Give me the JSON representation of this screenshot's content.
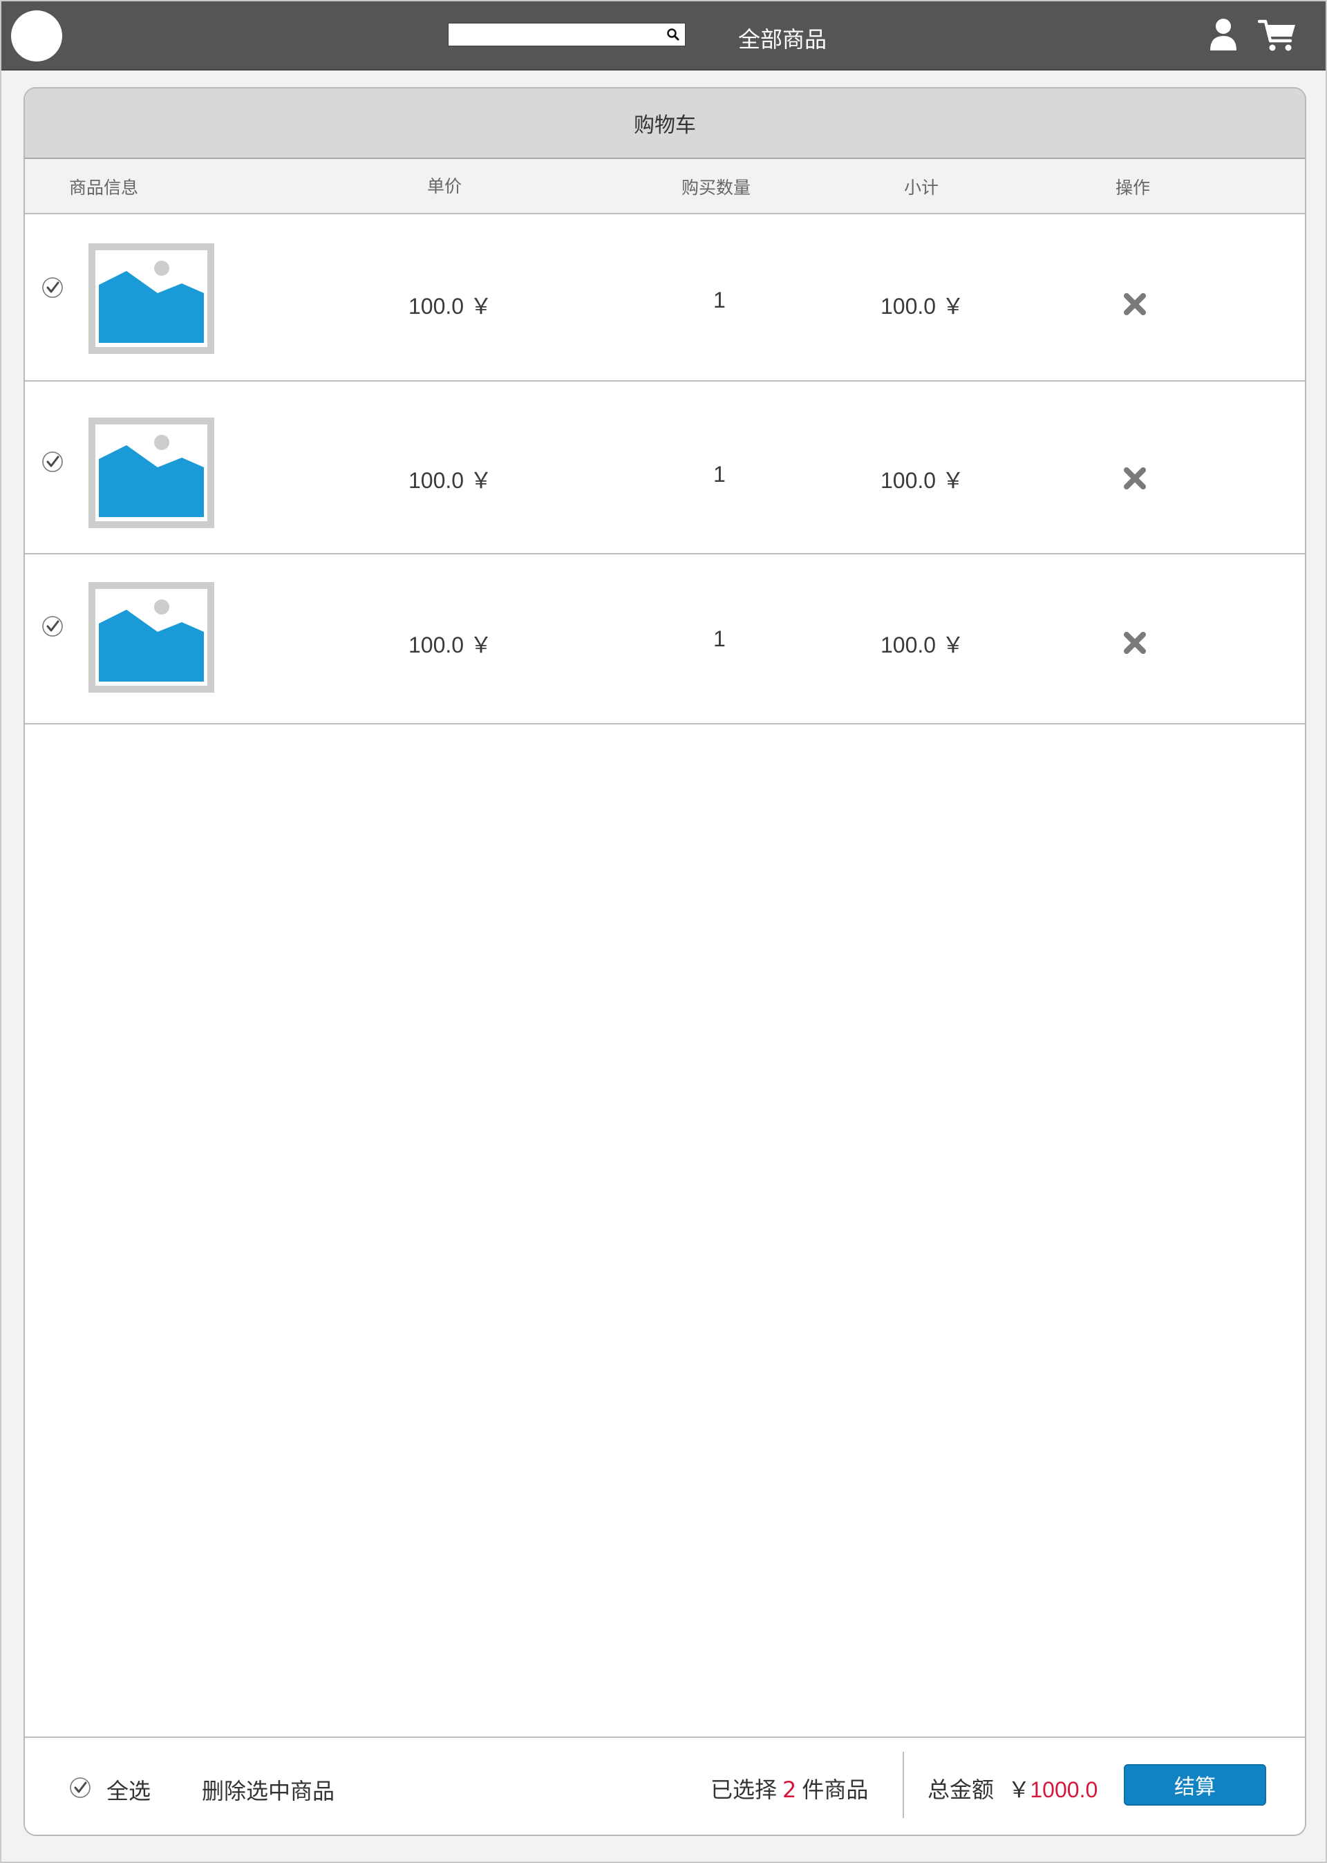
{
  "nav": {
    "search_placeholder": "",
    "all_products_label": "全部商品"
  },
  "cart": {
    "title": "购物车",
    "columns": {
      "info": "商品信息",
      "price": "单价",
      "quantity": "购买数量",
      "subtotal": "小计",
      "action": "操作"
    },
    "items": [
      {
        "checked": true,
        "price": "100.0 ￥",
        "quantity": "1",
        "subtotal": "100.0 ￥"
      },
      {
        "checked": true,
        "price": "100.0 ￥",
        "quantity": "1",
        "subtotal": "100.0 ￥"
      },
      {
        "checked": true,
        "price": "100.0 ￥",
        "quantity": "1",
        "subtotal": "100.0 ￥"
      }
    ]
  },
  "footer": {
    "select_all_label": "全选",
    "delete_selected_label": "删除选中商品",
    "selected_prefix": "已选择",
    "selected_count": "2",
    "selected_suffix": "件商品",
    "total_label": "总金额",
    "currency": "￥",
    "total_amount": "1000.0",
    "checkout_label": "结算"
  },
  "colors": {
    "nav_bg": "#555555",
    "accent": "#1283c2",
    "highlight": "#d6163a",
    "image_placeholder": "#1a9bd7"
  }
}
